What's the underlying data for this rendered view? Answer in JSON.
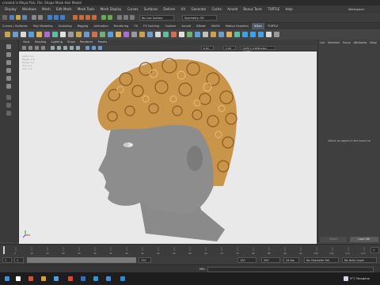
{
  "window": {
    "title": "created in Maya Pick, File, Shape Mask Hair Model"
  },
  "menubar": [
    "Display",
    "Windows",
    "Mesh",
    "Edit Mesh",
    "Mesh Tools",
    "Mesh Display",
    "Curves",
    "Surfaces",
    "Deform",
    "UV",
    "Generate",
    "Cache",
    "Arnold",
    "Bonus Tools",
    "TURTLE",
    "Help"
  ],
  "workspace": {
    "label": "Workspace:",
    "value": "Maya Classic"
  },
  "toolbar": {
    "live_surface": "No Live Surface",
    "symmetry": "Symmetry: Off"
  },
  "shelf_tabs": [
    "Curves / Surfaces",
    "Poly Modeling",
    "Sculpting",
    "Rigging",
    "Animation",
    "Rendering",
    "FX",
    "FX Caching",
    "Custom",
    "Arnold",
    "Bifrost",
    "MASH",
    "Motion Graphics",
    "XGen",
    "TURTLE"
  ],
  "viewport": {
    "menu": [
      "View",
      "Shading",
      "Lighting",
      "Show",
      "Renderer",
      "Panels"
    ],
    "exposure": "0.00",
    "gamma": "1.00",
    "color_space": "ACES 1.0 SDR-video (ACES)",
    "hud": {
      "rows": [
        {
          "label": "Verts:",
          "a": "0",
          "b": "0"
        },
        {
          "label": "Edges:",
          "a": "0",
          "b": "0"
        },
        {
          "label": "Faces:",
          "a": "0",
          "b": "0"
        },
        {
          "label": "Tris:",
          "a": "0",
          "b": "0"
        },
        {
          "label": "UVs:",
          "a": "0",
          "b": "0"
        }
      ]
    },
    "colors": {
      "background": "#e9e9e9",
      "skin": "#8d8d8d",
      "hair": "#c8954a"
    }
  },
  "attribute_panel": {
    "tabs": [
      "List",
      "Selected",
      "Focus",
      "Attributes",
      "Displ"
    ],
    "message": "Select an object in the scene to",
    "select_button": "Select",
    "load_button": "Load Attr"
  },
  "timeline": {
    "ticks": [
      "5",
      "10",
      "15",
      "20",
      "25",
      "30",
      "35",
      "40",
      "45",
      "50",
      "55",
      "60",
      "65",
      "70",
      "75",
      "80",
      "85",
      "90",
      "95",
      "100",
      "105",
      "110",
      "115"
    ],
    "current_frame": "1"
  },
  "range": {
    "start": "1",
    "inner_start": "1",
    "inner_end": "120",
    "end": "120",
    "end2": "200",
    "fps": "24 fps",
    "character_set": "No Character Set",
    "anim_layer": "No Anim Layer"
  },
  "command_line": {
    "label": "MEL",
    "value": ""
  },
  "taskbar": {
    "weather_temp": "9°C",
    "weather_desc": "Nuageux",
    "lang": "FRA"
  }
}
